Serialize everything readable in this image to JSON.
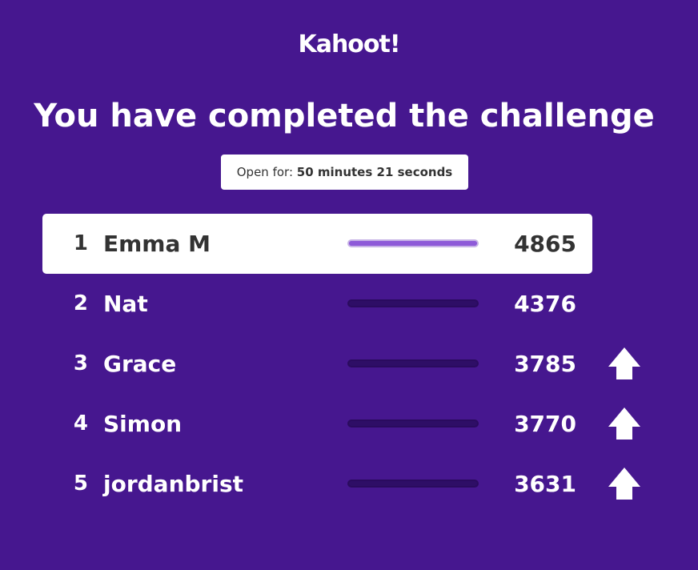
{
  "brand": {
    "logo_text": "Kahoot!"
  },
  "heading": "You have completed the challenge",
  "open_for": {
    "label": "Open for:",
    "value": "50 minutes 21 seconds"
  },
  "leaderboard": [
    {
      "rank": "1",
      "name": "Emma M",
      "score": "4865",
      "bar_fill": 1.0,
      "highlight": true,
      "arrow": false
    },
    {
      "rank": "2",
      "name": "Nat",
      "score": "4376",
      "bar_fill": 0.0,
      "highlight": false,
      "arrow": false
    },
    {
      "rank": "3",
      "name": "Grace",
      "score": "3785",
      "bar_fill": 0.0,
      "highlight": false,
      "arrow": true
    },
    {
      "rank": "4",
      "name": "Simon",
      "score": "3770",
      "bar_fill": 0.0,
      "highlight": false,
      "arrow": true
    },
    {
      "rank": "5",
      "name": "jordanbrist",
      "score": "3631",
      "bar_fill": 0.0,
      "highlight": false,
      "arrow": true
    }
  ],
  "icons": {
    "rank_up": "arrow-up-icon"
  },
  "colors": {
    "background": "#46178f",
    "highlight_row": "#ffffff",
    "bar_track": "#2e0e66",
    "bar_fill": "#8e5ad8",
    "text_light": "#ffffff",
    "text_dark": "#333333"
  }
}
